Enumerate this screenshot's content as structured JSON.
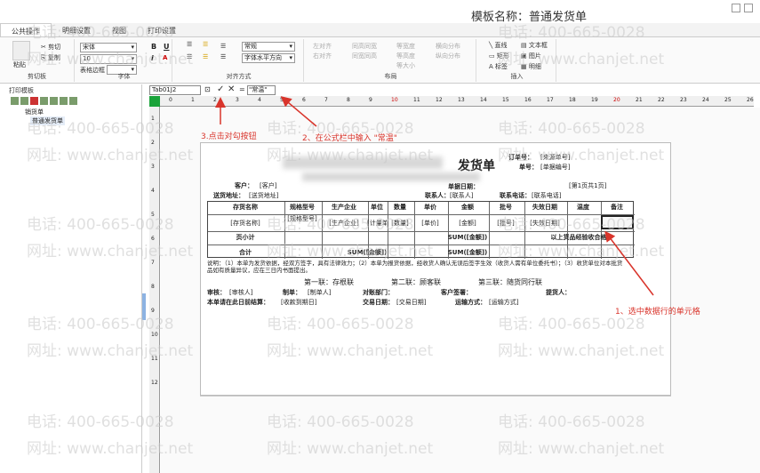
{
  "window": {
    "title": "模板名称：普通发货单"
  },
  "tabs": [
    "公共操作",
    "明细设置",
    "视图",
    "打印设置"
  ],
  "ribbon": {
    "clipboard": {
      "cut": "剪切",
      "copy": "复制",
      "paste": "粘贴",
      "group": "剪切板"
    },
    "font": {
      "family": "宋体",
      "size": "10",
      "border": "表格边框",
      "group": "字体",
      "bold": "B",
      "italic": "I",
      "underline": "U"
    },
    "align": {
      "format": "常规",
      "halign": "字体水平方向",
      "group": "对齐方式"
    },
    "layout": {
      "group": "布局",
      "items": [
        "左对齐",
        "同高同宽",
        "等宽度",
        "横向分布",
        "右对齐",
        "同宽同高",
        "等高度",
        "纵向分布",
        "等大小"
      ]
    },
    "insert": {
      "line": "直线",
      "textbox": "文本框",
      "rect": "矩形",
      "image": "图片",
      "label": "标签",
      "detail": "明细",
      "group": "插入"
    }
  },
  "left_panel": {
    "title": "打印模板",
    "root": "销货单",
    "child": "普通发货单"
  },
  "formula": {
    "cell_ref": "Tab01J2",
    "eq": "=",
    "value": "\"常温\"",
    "ok": "✓",
    "cancel": "✕",
    "fx": "⊡"
  },
  "ruler_h": [
    "0",
    "1",
    "2",
    "3",
    "4",
    "5",
    "6",
    "7",
    "8",
    "9",
    "10",
    "11",
    "12",
    "13",
    "14",
    "15",
    "16",
    "17",
    "18",
    "19",
    "20",
    "21",
    "22",
    "23",
    "24",
    "25",
    "26"
  ],
  "ruler_v": [
    "1",
    "2",
    "3",
    "4",
    "5",
    "6",
    "7",
    "8",
    "9",
    "10",
    "11",
    "12"
  ],
  "doc": {
    "title": "发货单",
    "order_no": "订单号：",
    "order_no_val": "[来源单号]",
    "bill_no": "单号：",
    "bill_no_val": "[单据编号]",
    "page": "[第1页共1页]",
    "customer": "客户：",
    "customer_val": "[客户]",
    "ship_addr": "送货地址：",
    "ship_addr_val": "[送货地址]",
    "contact": "联系人：",
    "contact_val": "[联系人]",
    "phone": "联系电话：",
    "phone_val": "[联系电话]",
    "bill_date": "单据日期：",
    "headers": [
      "存货名称",
      "规格型号",
      "生产企业",
      "单位",
      "数量",
      "单价",
      "金额",
      "批号",
      "失效日期",
      "温度",
      "备注"
    ],
    "row": [
      "[存货名称]",
      "[规格型号]",
      "[生产企业]",
      "[计量单位]",
      "[数量]",
      "[单价]",
      "[金额]",
      "[批号]",
      "[失效日期]",
      "",
      ""
    ],
    "subtotal": "页小计",
    "subtotal_sum": "SUM([金额])",
    "total": "合计",
    "total_sum": "SUM([金额])",
    "total_sum2": "SUM([金额])",
    "qualified": "以上货品经验收合格",
    "note1": "说明：（1）本单为发货依据，经双方签字，具有法律效力；（2）本单为报货依据，经收货人确认无误后签字生效（收货人需有单位委托书）；（3）收货单位对本批货品如有质量异议，应在三日内书面提出。",
    "copies": [
      "第一联：存根联",
      "第二联：顾客联",
      "第三联：随货同行联"
    ],
    "auditor": "审核：",
    "auditor_val": "[审核人]",
    "maker": "制单：",
    "maker_val": "[制单人]",
    "dept": "对账部门：",
    "sign": "客户签署：",
    "picker": "提货人：",
    "settle": "本单请在此日前结算：",
    "settle_val": "[收款到期日]",
    "trade_date": "交易日期：",
    "trade_date_val": "[交易日期]",
    "ship_method": "运输方式：",
    "ship_method_val": "[运输方式]"
  },
  "annotations": {
    "step1": "1、选中数据行的单元格",
    "step2": "2、在公式栏中输入 \"常温\"",
    "step3": "3.点击对勾按钮",
    "color": "#d9342b"
  },
  "watermarks": [
    "电话: 400-665-0028",
    "网址: www.chanjet.net"
  ]
}
